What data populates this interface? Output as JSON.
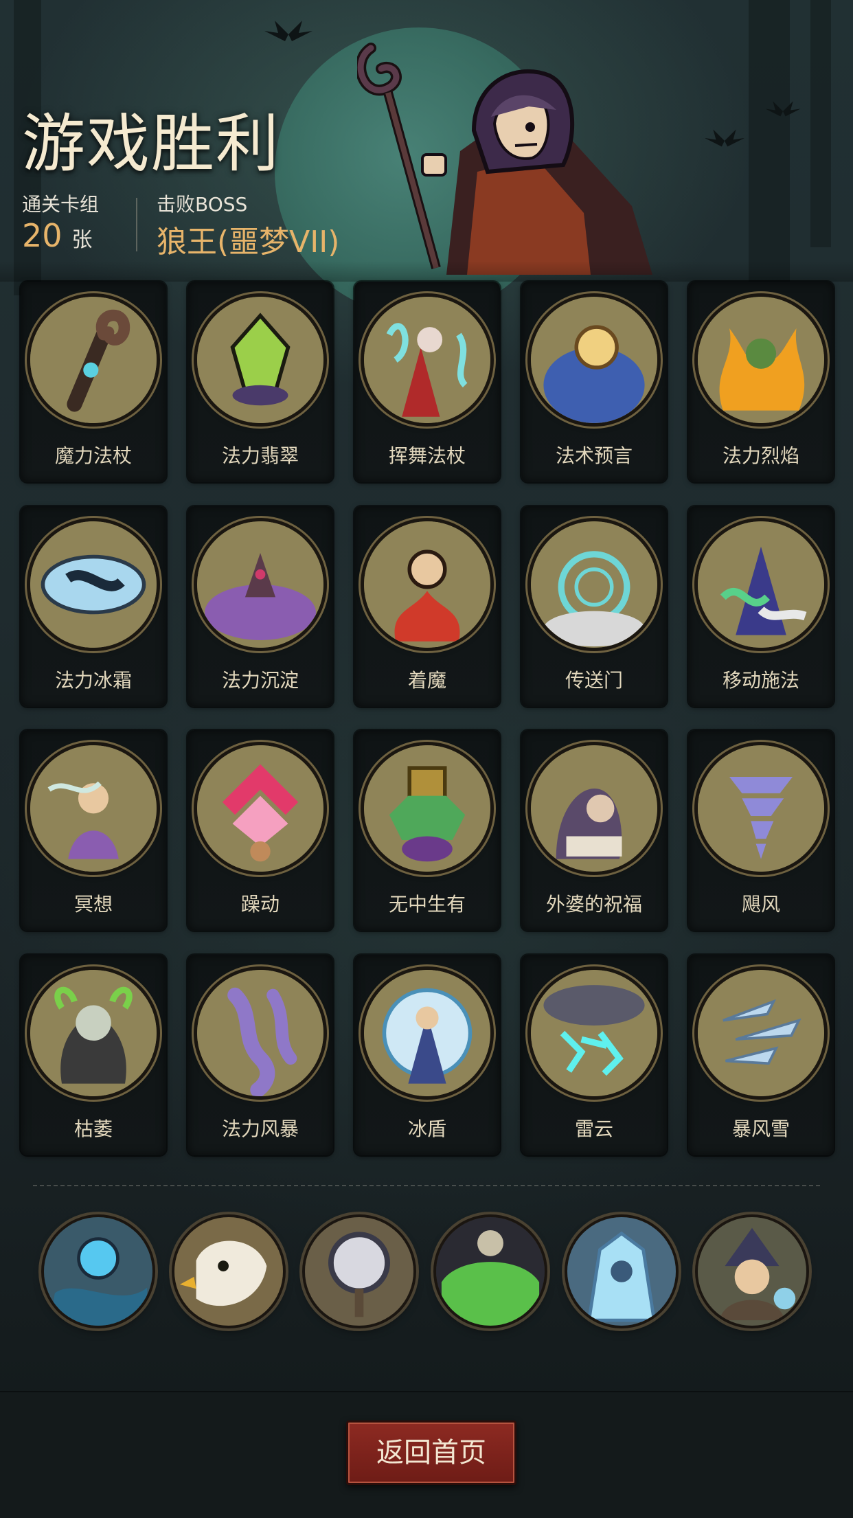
{
  "header": {
    "title": "游戏胜利",
    "deck_label": "通关卡组",
    "deck_count": "20",
    "deck_unit": "张",
    "boss_label": "击败BOSS",
    "boss_name": "狼王(噩梦VII)"
  },
  "cards": [
    {
      "name": "魔力法杖",
      "icon": "staff-icon",
      "bg": "#8f8458",
      "accent": "#6b4a3a"
    },
    {
      "name": "法力翡翠",
      "icon": "emerald-icon",
      "bg": "#8f8458",
      "accent": "#9bcf4a"
    },
    {
      "name": "挥舞法杖",
      "icon": "wielding-mage-icon",
      "bg": "#8f8458",
      "accent": "#7fe0e0"
    },
    {
      "name": "法术预言",
      "icon": "orb-prophecy-icon",
      "bg": "#8f8458",
      "accent": "#3e5fb0"
    },
    {
      "name": "法力烈焰",
      "icon": "flame-icon",
      "bg": "#8f8458",
      "accent": "#f0a020"
    },
    {
      "name": "法力冰霜",
      "icon": "frost-icon",
      "bg": "#8f8458",
      "accent": "#a9d7ee"
    },
    {
      "name": "法力沉淀",
      "icon": "sediment-icon",
      "bg": "#8f8458",
      "accent": "#8a5db0"
    },
    {
      "name": "着魔",
      "icon": "possessed-icon",
      "bg": "#8f8458",
      "accent": "#d03a2a"
    },
    {
      "name": "传送门",
      "icon": "portal-icon",
      "bg": "#8f8458",
      "accent": "#6ed6d6"
    },
    {
      "name": "移动施法",
      "icon": "moving-cast-icon",
      "bg": "#8f8458",
      "accent": "#58d08a"
    },
    {
      "name": "冥想",
      "icon": "meditation-icon",
      "bg": "#8f8458",
      "accent": "#8a5db0"
    },
    {
      "name": "躁动",
      "icon": "frenzy-icon",
      "bg": "#8f8458",
      "accent": "#e23a6a"
    },
    {
      "name": "无中生有",
      "icon": "creation-icon",
      "bg": "#8f8458",
      "accent": "#4fa85a"
    },
    {
      "name": "外婆的祝福",
      "icon": "grandma-blessing-icon",
      "bg": "#8f8458",
      "accent": "#5a4a6a"
    },
    {
      "name": "飓风",
      "icon": "hurricane-icon",
      "bg": "#8f8458",
      "accent": "#8f8ad8"
    },
    {
      "name": "枯萎",
      "icon": "wither-icon",
      "bg": "#8f8458",
      "accent": "#7ad04a"
    },
    {
      "name": "法力风暴",
      "icon": "mana-storm-icon",
      "bg": "#8f8458",
      "accent": "#8f78c8"
    },
    {
      "name": "冰盾",
      "icon": "ice-shield-icon",
      "bg": "#8f8458",
      "accent": "#cfe8f5"
    },
    {
      "name": "雷云",
      "icon": "thundercloud-icon",
      "bg": "#8f8458",
      "accent": "#5ff0ee"
    },
    {
      "name": "暴风雪",
      "icon": "blizzard-icon",
      "bg": "#8f8458",
      "accent": "#bcd8ee"
    }
  ],
  "relics": [
    {
      "icon": "crystal-ball-icon",
      "bg": "#3a5a6a",
      "accent": "#56c8f0"
    },
    {
      "icon": "eagle-icon",
      "bg": "#7a6a48",
      "accent": "#f0eadc"
    },
    {
      "icon": "mirror-icon",
      "bg": "#6a5f48",
      "accent": "#d8d8e0"
    },
    {
      "icon": "skull-poison-icon",
      "bg": "#2a2a32",
      "accent": "#5ac04a"
    },
    {
      "icon": "ice-golem-icon",
      "bg": "#4a6a80",
      "accent": "#a8e0f5"
    },
    {
      "icon": "wizard-portrait-icon",
      "bg": "#5a5a48",
      "accent": "#8fd0e8"
    }
  ],
  "footer": {
    "home_label": "返回首页"
  },
  "colors": {
    "title": "#f5ead0",
    "stat_value": "#e7b46a",
    "button": "#7a2219"
  }
}
